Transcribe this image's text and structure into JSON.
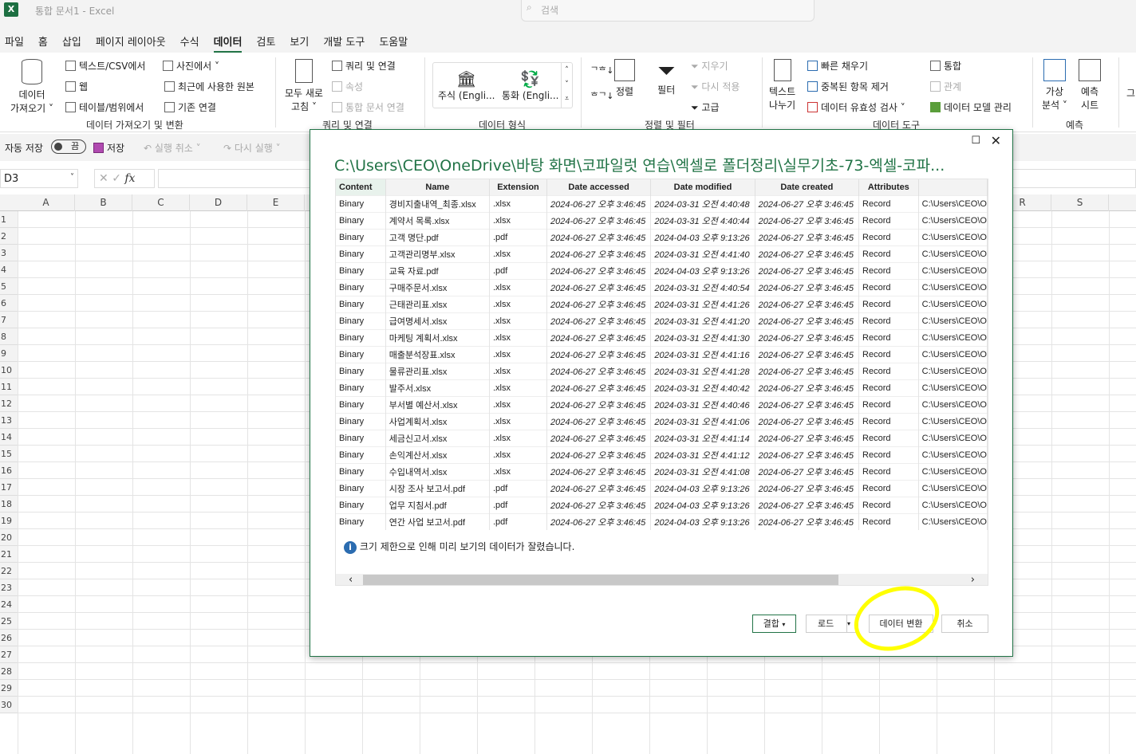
{
  "app": {
    "title": "통합 문서1  -  Excel",
    "logo": "X",
    "search_placeholder": "검색"
  },
  "tabs": [
    "파일",
    "홈",
    "삽입",
    "페이지 레이아웃",
    "수식",
    "데이터",
    "검토",
    "보기",
    "개발 도구",
    "도움말"
  ],
  "active_tab": "데이터",
  "ribbon": {
    "get_data": "데이터\n가져오기 ˅",
    "from_text": "텍스트/CSV에서",
    "from_web": "웹",
    "from_table": "테이블/범위에서",
    "from_picture": "사진에서 ˅",
    "recent_sources": "최근에 사용한 원본",
    "existing_conn": "기존 연결",
    "group1": "데이터 가져오기 및 변환",
    "refresh_all": "모두 새로\n고침 ˅",
    "queries": "쿼리 및 연결",
    "properties": "속성",
    "workbook_links": "통합 문서 연결",
    "group2": "쿼리 및 연결",
    "stocks": "주식 (Engli...",
    "currency": "통화 (Engli...",
    "group3": "데이터 형식",
    "sort": "정렬",
    "filter": "필터",
    "clear": "지우기",
    "reapply": "다시 적용",
    "advanced": "고급",
    "group4": "정렬 및 필터",
    "text_to_cols": "텍스트\n나누기",
    "flash_fill": "빠른 채우기",
    "remove_dup": "중복된 항목 제거",
    "validation": "데이터 유효성 검사",
    "consolidate": "통합",
    "relationships": "관계",
    "data_model": "데이터 모델 관리",
    "group5": "데이터 도구",
    "whatif": "가상\n분석 ˅",
    "forecast_sheet": "예측\n시트",
    "group6": "예측",
    "outline": "그"
  },
  "qat": {
    "autosave": "자동 저장",
    "toggle": "끔",
    "save": "저장",
    "undo": "실행 취소",
    "redo": "다시 실행"
  },
  "formula_bar": {
    "name_box": "D3",
    "fx": "fx"
  },
  "columns": [
    "A",
    "B",
    "C",
    "D",
    "E",
    "R",
    "S"
  ],
  "rows": [
    "1",
    "2",
    "3",
    "4",
    "5",
    "6",
    "7",
    "8",
    "9",
    "10",
    "11",
    "12",
    "13",
    "14",
    "15",
    "16",
    "17",
    "18",
    "19",
    "20",
    "21",
    "22",
    "23",
    "24",
    "25",
    "26",
    "27",
    "28",
    "29",
    "30"
  ],
  "dialog": {
    "title": "C:\\Users\\CEO\\OneDrive\\바탕 화면\\코파일럿 연습\\엑셀로 폴더정리\\실무기초-73-엑셀-코파...",
    "headers": [
      "Content",
      "Name",
      "Extension",
      "Date accessed",
      "Date modified",
      "Date created",
      "Attributes",
      ""
    ],
    "rows": [
      [
        "Binary",
        "경비지출내역_최종.xlsx",
        ".xlsx",
        "2024-06-27 오후 3:46:45",
        "2024-03-31 오전 4:40:48",
        "2024-06-27 오후 3:46:45",
        "Record",
        "C:\\Users\\CEO\\O"
      ],
      [
        "Binary",
        "계약서 목록.xlsx",
        ".xlsx",
        "2024-06-27 오후 3:46:45",
        "2024-03-31 오전 4:40:44",
        "2024-06-27 오후 3:46:45",
        "Record",
        "C:\\Users\\CEO\\O"
      ],
      [
        "Binary",
        "고객 명단.pdf",
        ".pdf",
        "2024-06-27 오후 3:46:45",
        "2024-04-03 오후 9:13:26",
        "2024-06-27 오후 3:46:45",
        "Record",
        "C:\\Users\\CEO\\O"
      ],
      [
        "Binary",
        "고객관리명부.xlsx",
        ".xlsx",
        "2024-06-27 오후 3:46:45",
        "2024-03-31 오전 4:41:40",
        "2024-06-27 오후 3:46:45",
        "Record",
        "C:\\Users\\CEO\\O"
      ],
      [
        "Binary",
        "교육 자료.pdf",
        ".pdf",
        "2024-06-27 오후 3:46:45",
        "2024-04-03 오후 9:13:26",
        "2024-06-27 오후 3:46:45",
        "Record",
        "C:\\Users\\CEO\\O"
      ],
      [
        "Binary",
        "구매주문서.xlsx",
        ".xlsx",
        "2024-06-27 오후 3:46:45",
        "2024-03-31 오전 4:40:54",
        "2024-06-27 오후 3:46:45",
        "Record",
        "C:\\Users\\CEO\\O"
      ],
      [
        "Binary",
        "근태관리표.xlsx",
        ".xlsx",
        "2024-06-27 오후 3:46:45",
        "2024-03-31 오전 4:41:26",
        "2024-06-27 오후 3:46:45",
        "Record",
        "C:\\Users\\CEO\\O"
      ],
      [
        "Binary",
        "급여명세서.xlsx",
        ".xlsx",
        "2024-06-27 오후 3:46:45",
        "2024-03-31 오전 4:41:20",
        "2024-06-27 오후 3:46:45",
        "Record",
        "C:\\Users\\CEO\\O"
      ],
      [
        "Binary",
        "마케팅 계획서.xlsx",
        ".xlsx",
        "2024-06-27 오후 3:46:45",
        "2024-03-31 오전 4:41:30",
        "2024-06-27 오후 3:46:45",
        "Record",
        "C:\\Users\\CEO\\O"
      ],
      [
        "Binary",
        "매출분석장표.xlsx",
        ".xlsx",
        "2024-06-27 오후 3:46:45",
        "2024-03-31 오전 4:41:16",
        "2024-06-27 오후 3:46:45",
        "Record",
        "C:\\Users\\CEO\\O"
      ],
      [
        "Binary",
        "물류관리표.xlsx",
        ".xlsx",
        "2024-06-27 오후 3:46:45",
        "2024-03-31 오전 4:41:28",
        "2024-06-27 오후 3:46:45",
        "Record",
        "C:\\Users\\CEO\\O"
      ],
      [
        "Binary",
        "발주서.xlsx",
        ".xlsx",
        "2024-06-27 오후 3:46:45",
        "2024-03-31 오전 4:40:42",
        "2024-06-27 오후 3:46:45",
        "Record",
        "C:\\Users\\CEO\\O"
      ],
      [
        "Binary",
        "부서별 예산서.xlsx",
        ".xlsx",
        "2024-06-27 오후 3:46:45",
        "2024-03-31 오전 4:40:46",
        "2024-06-27 오후 3:46:45",
        "Record",
        "C:\\Users\\CEO\\O"
      ],
      [
        "Binary",
        "사업계획서.xlsx",
        ".xlsx",
        "2024-06-27 오후 3:46:45",
        "2024-03-31 오전 4:41:06",
        "2024-06-27 오후 3:46:45",
        "Record",
        "C:\\Users\\CEO\\O"
      ],
      [
        "Binary",
        "세금신고서.xlsx",
        ".xlsx",
        "2024-06-27 오후 3:46:45",
        "2024-03-31 오전 4:41:14",
        "2024-06-27 오후 3:46:45",
        "Record",
        "C:\\Users\\CEO\\O"
      ],
      [
        "Binary",
        "손익계산서.xlsx",
        ".xlsx",
        "2024-06-27 오후 3:46:45",
        "2024-03-31 오전 4:41:12",
        "2024-06-27 오후 3:46:45",
        "Record",
        "C:\\Users\\CEO\\O"
      ],
      [
        "Binary",
        "수입내역서.xlsx",
        ".xlsx",
        "2024-06-27 오후 3:46:45",
        "2024-03-31 오전 4:41:08",
        "2024-06-27 오후 3:46:45",
        "Record",
        "C:\\Users\\CEO\\O"
      ],
      [
        "Binary",
        "시장 조사 보고서.pdf",
        ".pdf",
        "2024-06-27 오후 3:46:45",
        "2024-04-03 오후 9:13:26",
        "2024-06-27 오후 3:46:45",
        "Record",
        "C:\\Users\\CEO\\O"
      ],
      [
        "Binary",
        "업무 지침서.pdf",
        ".pdf",
        "2024-06-27 오후 3:46:45",
        "2024-04-03 오후 9:13:26",
        "2024-06-27 오후 3:46:45",
        "Record",
        "C:\\Users\\CEO\\O"
      ],
      [
        "Binary",
        "연간 사업 보고서.pdf",
        ".pdf",
        "2024-06-27 오후 3:46:45",
        "2024-04-03 오후 9:13:26",
        "2024-06-27 오후 3:46:45",
        "Record",
        "C:\\Users\\CEO\\O"
      ]
    ],
    "info": "크기 제한으로 인해 미리 보기의 데이터가 잘렸습니다.",
    "buttons": {
      "combine": "결합",
      "load": "로드",
      "transform": "데이터 변환",
      "cancel": "취소"
    }
  },
  "colors": {
    "accent": "#217346",
    "highlight": "#ffff00"
  }
}
